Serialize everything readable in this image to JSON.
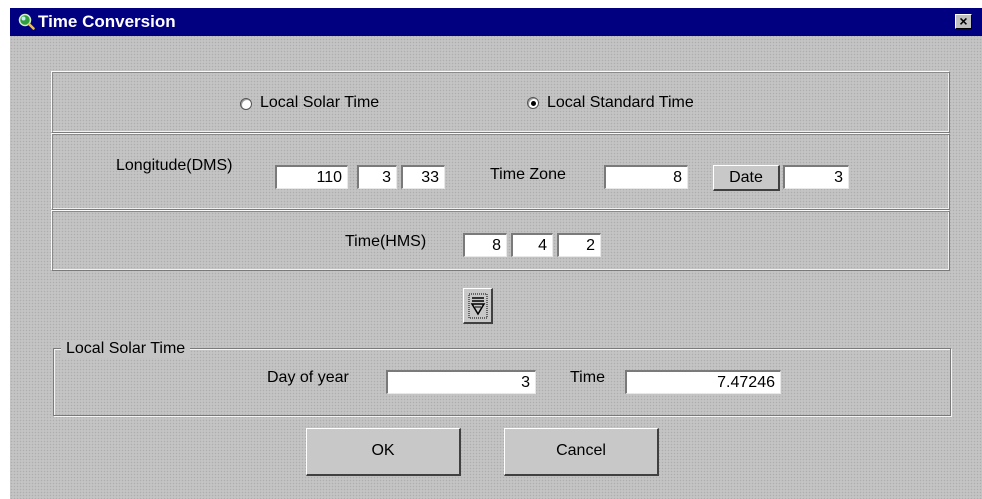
{
  "window": {
    "title": "Time Conversion",
    "close_glyph": "×",
    "icon": "magnifier-globe-icon"
  },
  "mode": {
    "options": [
      "Local Solar Time",
      "Local Standard Time"
    ],
    "selected": "Local Standard Time"
  },
  "longitude": {
    "label": "Longitude(DMS)",
    "degrees": "110",
    "minutes": "3",
    "seconds": "33"
  },
  "time_zone": {
    "label": "Time Zone",
    "value": "8"
  },
  "date": {
    "button_label": "Date",
    "value": "3"
  },
  "time": {
    "label": "Time(HMS)",
    "hours": "8",
    "minutes": "4",
    "seconds": "2"
  },
  "convert_button": {
    "icon": "convert-down-arrow-icon"
  },
  "result": {
    "group_label": "Local Solar Time",
    "day_of_year_label": "Day of year",
    "day_of_year": "3",
    "time_label": "Time",
    "time": "7.47246"
  },
  "buttons": {
    "ok": "OK",
    "cancel": "Cancel"
  },
  "colors": {
    "titlebar": "#000080",
    "dialog_bg": "#c4c4c4"
  }
}
